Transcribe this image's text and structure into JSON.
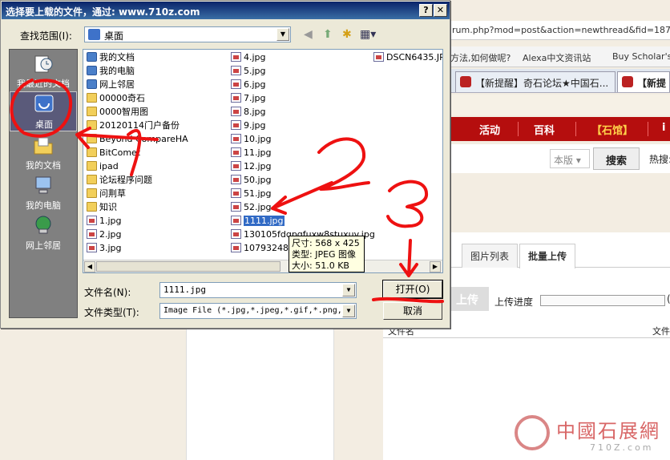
{
  "dialog": {
    "title": "选择要上载的文件，通过: www.710z.com",
    "help_btn": "?",
    "close_btn": "✕",
    "lookin_label": "查找范围(I):",
    "lookin_value": "桌面",
    "nav_icons": [
      "back-icon",
      "up-folder-icon",
      "new-folder-icon",
      "view-menu-icon"
    ],
    "places": [
      {
        "label": "我最近的文档",
        "icon": "recent-documents-icon"
      },
      {
        "label": "桌面",
        "icon": "desktop-icon"
      },
      {
        "label": "我的文档",
        "icon": "my-documents-icon"
      },
      {
        "label": "我的电脑",
        "icon": "my-computer-icon"
      },
      {
        "label": "网上邻居",
        "icon": "network-places-icon"
      }
    ],
    "files_col1": [
      {
        "name": "我的文档",
        "type": "sys"
      },
      {
        "name": "我的电脑",
        "type": "sys"
      },
      {
        "name": "网上邻居",
        "type": "sys"
      },
      {
        "name": "00000奇石",
        "type": "folder"
      },
      {
        "name": "0000智用图",
        "type": "folder"
      },
      {
        "name": "20120114门户备份",
        "type": "folder"
      },
      {
        "name": "Beyond CompareHA",
        "type": "folder"
      },
      {
        "name": "BitComet",
        "type": "folder"
      },
      {
        "name": "ipad",
        "type": "folder"
      },
      {
        "name": "论坛程序问题",
        "type": "folder"
      },
      {
        "name": "问荆草",
        "type": "folder"
      },
      {
        "name": "知识",
        "type": "folder"
      },
      {
        "name": "1.jpg",
        "type": "img"
      },
      {
        "name": "2.jpg",
        "type": "img"
      },
      {
        "name": "3.jpg",
        "type": "img"
      }
    ],
    "files_col2": [
      {
        "name": "4.jpg",
        "type": "img"
      },
      {
        "name": "5.jpg",
        "type": "img"
      },
      {
        "name": "6.jpg",
        "type": "img"
      },
      {
        "name": "7.jpg",
        "type": "img"
      },
      {
        "name": "8.jpg",
        "type": "img"
      },
      {
        "name": "9.jpg",
        "type": "img"
      },
      {
        "name": "10.jpg",
        "type": "img"
      },
      {
        "name": "11.jpg",
        "type": "img"
      },
      {
        "name": "12.jpg",
        "type": "img"
      },
      {
        "name": "50.jpg",
        "type": "img"
      },
      {
        "name": "51.jpg",
        "type": "img"
      },
      {
        "name": "52.jpg",
        "type": "img"
      },
      {
        "name": "1111.jpg",
        "type": "img",
        "selected": true
      },
      {
        "name": "130105fdqpgfuxw8stuxuv.jpg",
        "type": "img"
      },
      {
        "name": "10793248_",
        "type": "img"
      }
    ],
    "files_col3": [
      {
        "name": "DSCN6435.JPG",
        "type": "img"
      }
    ],
    "tooltip": {
      "size": "尺寸: 568 x 425",
      "type": "类型: JPEG 图像",
      "bytes": "大小: 51.0 KB"
    },
    "filename_label": "文件名(N):",
    "filename_value": "1111.jpg",
    "filetype_label": "文件类型(T):",
    "filetype_value": "Image File (*.jpg,*.jpeg,*.gif,*.png,",
    "open_btn": "打开(O)",
    "cancel_btn": "取消"
  },
  "browser": {
    "address": "rum.php?mod=post&action=newthread&fid=187&referer",
    "fav1": "方法,如何做呢?",
    "fav2": "Alexa中文资讯站",
    "fav3": "Buy Scholar's R",
    "tab1": "【新提醒】奇石论坛★中国石...",
    "tab2": "【新提",
    "nav": [
      "活动",
      "百科",
      "【石馆】",
      "i"
    ],
    "scope": "本版",
    "search_btn": "搜索",
    "hot": "热搜:",
    "upload_tabs": [
      "图片列表",
      "批量上传"
    ],
    "upload_btn": "上传",
    "progress_label": "上传进度",
    "progress_paren": "(",
    "col_filename": "文件名",
    "col_file": "文件"
  },
  "watermark": {
    "title": "中國石展網",
    "sub": "710Z.com"
  },
  "annotations": [
    "1",
    "2",
    "3"
  ]
}
